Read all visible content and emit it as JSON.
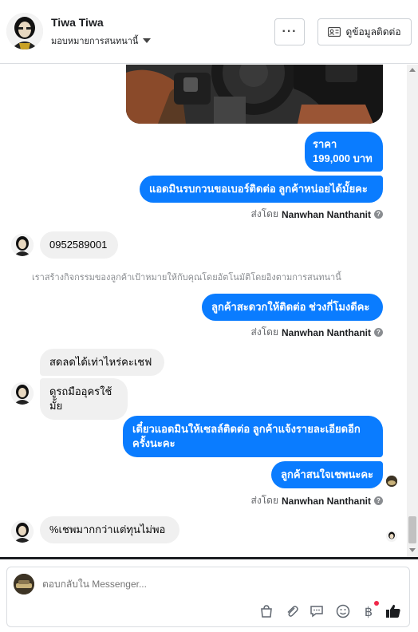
{
  "header": {
    "name": "Tiwa Tiwa",
    "subtitle": "มอบหมายการสนทนานี้",
    "more_label": "···",
    "contact_label": "ดูข้อมูลติดต่อ"
  },
  "messages": {
    "price_line1": "ราคา",
    "price_line2": "199,000 บาท",
    "ask_number": "แอดมินรบกวนขอเบอร์ติดต่อ ลูกค้าหน่อยได้มั้ยคะ",
    "sent_by_prefix": "ส่งโดย",
    "agent_name": "Nanwhan Nanthanit",
    "customer_phone": "0952589001",
    "system_note": "เราสร้างกิจกรรมของลูกค้าเป้าหมายให้กับคุณโดยอัตโนมัติโดยอิงตามการสนทนานี้",
    "ask_time": "ลูกค้าสะดวกให้ติดต่อ ช่วงกี่โมงดีคะ",
    "customer_discount": "สดลดได้เท่าไหร่คะเชฟ",
    "customer_view": "ดูรถมืออุครใช้มั้ย",
    "sales_contact_line1": "เดี๋ยวแอดมินให้เซลล์ติดต่อ ลูกค้าแจ้งรายละเอียดอีก",
    "sales_contact_line2": "ครั้งนะคะ",
    "interested": "ลูกค้าสนใจเชพนะคะ",
    "customer_last": "%เชพมากกว่าแต่ทุนไม่พอ"
  },
  "composer": {
    "placeholder": "ตอบกลับใน Messenger..."
  },
  "icons": {
    "info": "info-icon",
    "bag": "shopping-bag-icon",
    "attach": "paperclip-icon",
    "saved_reply": "chat-bubble-icon",
    "emoji": "smiley-icon",
    "payment": "baht-icon",
    "like": "thumbs-up-icon"
  },
  "colors": {
    "outgoing_bubble": "#0a7cff",
    "incoming_bubble": "#f0f0f0",
    "like_icon": "#1c1e21",
    "notification_dot": "#f02849"
  }
}
